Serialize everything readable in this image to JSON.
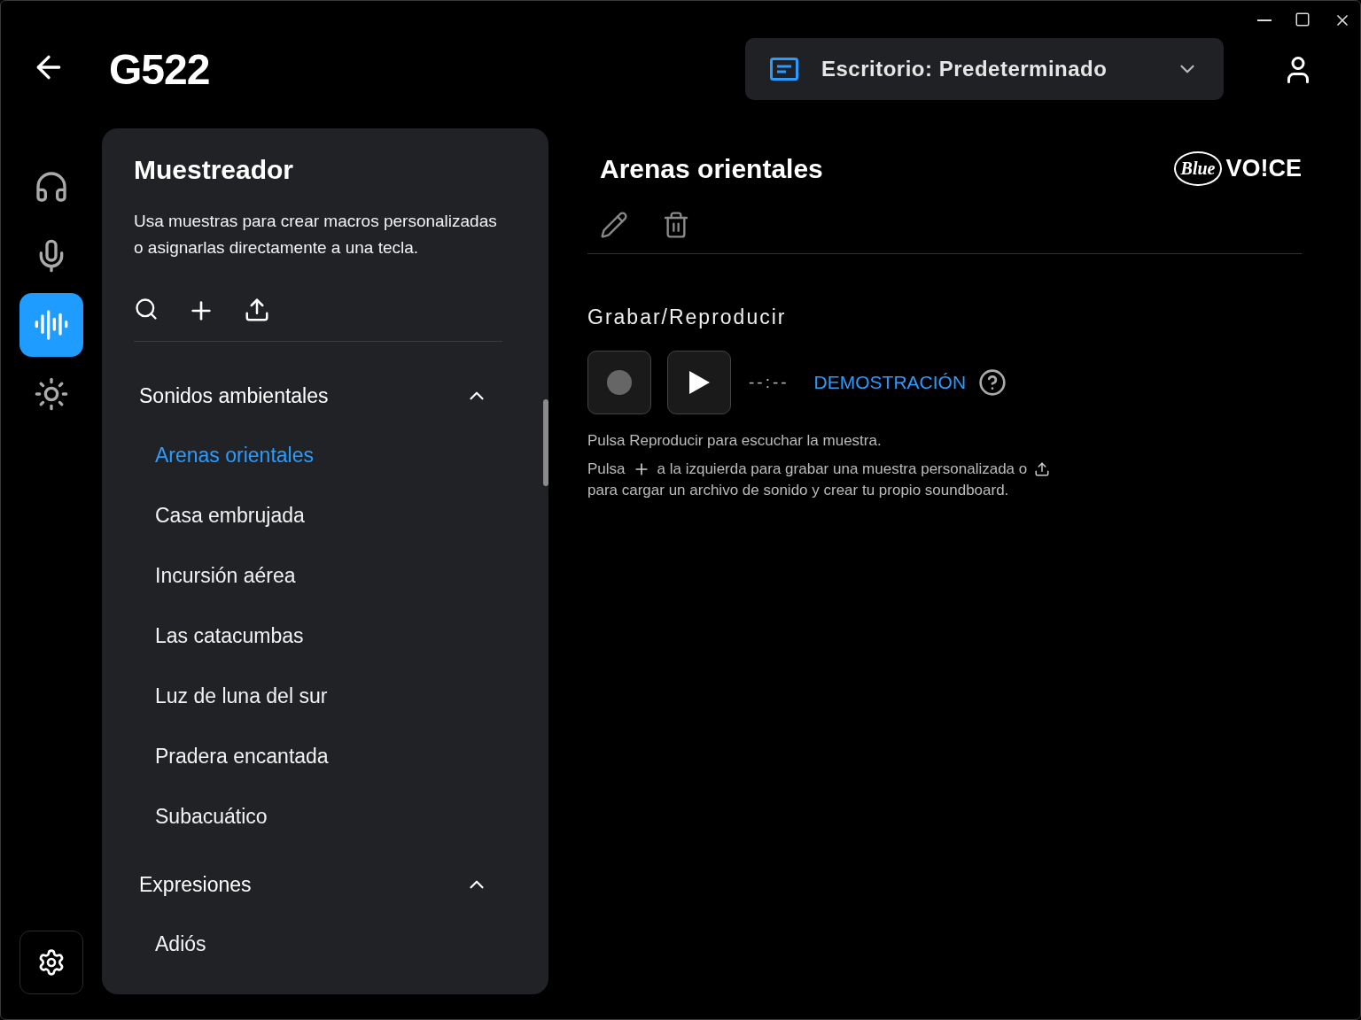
{
  "header": {
    "title": "G522",
    "profile": "Escritorio: Predeterminado"
  },
  "nav": [
    {
      "kind": "headset",
      "selected": false
    },
    {
      "kind": "mic",
      "selected": false
    },
    {
      "kind": "sampler",
      "selected": true
    },
    {
      "kind": "light",
      "selected": false
    }
  ],
  "panel": {
    "title": "Muestreador",
    "description": "Usa muestras para crear macros personalizadas o asignarlas directamente a una tecla.",
    "categories": [
      {
        "label": "Sonidos ambientales",
        "expanded": true,
        "children": [
          {
            "label": "Arenas orientales",
            "selected": true
          },
          {
            "label": "Casa embrujada",
            "selected": false
          },
          {
            "label": "Incursión aérea",
            "selected": false
          },
          {
            "label": "Las catacumbas",
            "selected": false
          },
          {
            "label": "Luz de luna del sur",
            "selected": false
          },
          {
            "label": "Pradera encantada",
            "selected": false
          },
          {
            "label": "Subacuático",
            "selected": false
          }
        ]
      },
      {
        "label": "Expresiones",
        "expanded": true,
        "children": [
          {
            "label": "Adiós",
            "selected": false
          }
        ]
      }
    ]
  },
  "detail": {
    "title": "Arenas orientales",
    "logo": {
      "brand": "Blue",
      "product": "VO!CE"
    },
    "section": "Grabar/Reproducir",
    "time": "--:--",
    "demo": "DEMOSTRACIÓN",
    "hint_1": "Pulsa Reproducir para escuchar la muestra.",
    "hint_2": [
      "Pulsa",
      "a la izquierda para grabar una muestra personalizada o",
      "para cargar un archivo de sonido y crear tu propio soundboard."
    ]
  }
}
